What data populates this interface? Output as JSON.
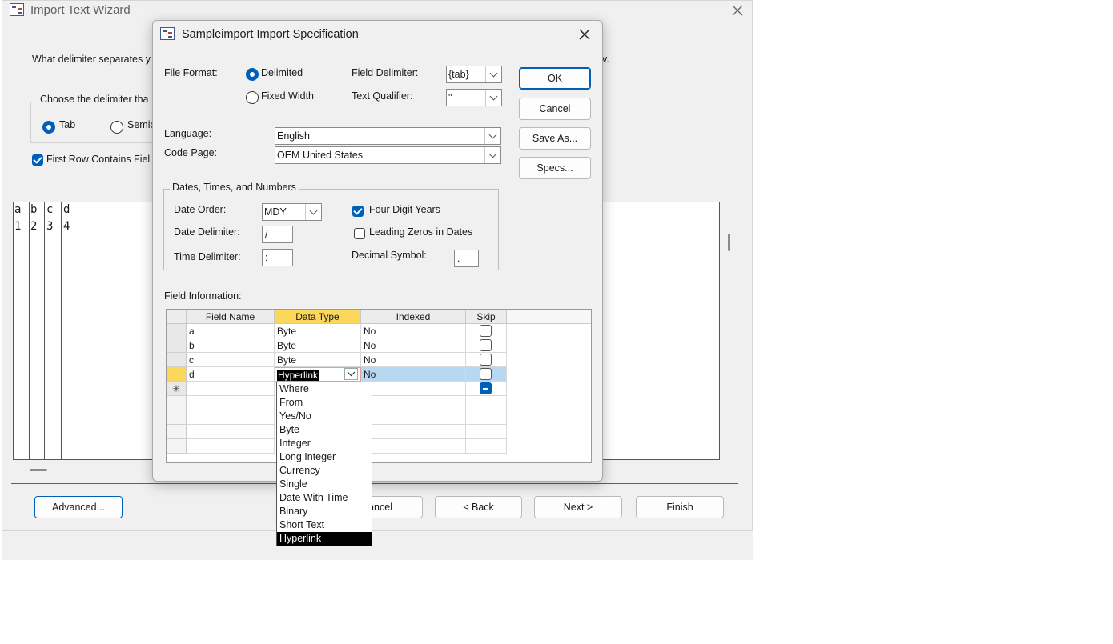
{
  "wizard": {
    "title": "Import Text Wizard",
    "question": "What delimiter separates y",
    "question_end": "v.",
    "delimiter_group": "Choose the delimiter tha",
    "options": [
      {
        "label": "Tab",
        "checked": true
      },
      {
        "label": "Semic",
        "checked": false
      }
    ],
    "first_row": {
      "label": "First Row Contains Fiel",
      "checked": true
    },
    "preview": {
      "headers": [
        "a",
        "b",
        "c",
        "d"
      ],
      "rows": [
        [
          "1",
          "2",
          "3",
          "4"
        ]
      ]
    },
    "buttons": {
      "advanced": "Advanced...",
      "cancel": "ancel",
      "back": "< Back",
      "next": "Next >",
      "finish": "Finish"
    }
  },
  "spec": {
    "title": "Sampleimport Import Specification",
    "file_format_label": "File Format:",
    "format_options": [
      {
        "label": "Delimited",
        "checked": true
      },
      {
        "label": "Fixed Width",
        "checked": false
      }
    ],
    "field_delimiter_label": "Field Delimiter:",
    "field_delimiter_value": "{tab}",
    "text_qualifier_label": "Text Qualifier:",
    "text_qualifier_value": "\"",
    "language_label": "Language:",
    "language_value": "English",
    "code_page_label": "Code Page:",
    "code_page_value": "OEM United States",
    "buttons": {
      "ok": "OK",
      "cancel": "Cancel",
      "save_as": "Save As...",
      "specs": "Specs..."
    },
    "dates_group": "Dates, Times, and Numbers",
    "date_order_label": "Date Order:",
    "date_order_value": "MDY",
    "date_delimiter_label": "Date Delimiter:",
    "date_delimiter_value": "/",
    "time_delimiter_label": "Time Delimiter:",
    "time_delimiter_value": ":",
    "four_digit_years": {
      "label": "Four Digit Years",
      "checked": true
    },
    "leading_zeros": {
      "label": "Leading Zeros in Dates",
      "checked": false
    },
    "decimal_symbol_label": "Decimal Symbol:",
    "decimal_symbol_value": ".",
    "field_info_label": "Field Information:",
    "columns": [
      "Field Name",
      "Data Type",
      "Indexed",
      "Skip"
    ],
    "rows": [
      {
        "name": "a",
        "type": "Byte",
        "indexed": "No"
      },
      {
        "name": "b",
        "type": "Byte",
        "indexed": "No"
      },
      {
        "name": "c",
        "type": "Byte",
        "indexed": "No"
      },
      {
        "name": "d",
        "type": "Hyperlink",
        "indexed": "No"
      }
    ],
    "new_row_marker": "✳",
    "type_options": [
      "Where",
      "From",
      "Yes/No",
      "Byte",
      "Integer",
      "Long Integer",
      "Currency",
      "Single",
      "Date With Time",
      "Binary",
      "Short Text",
      "Hyperlink"
    ],
    "selected_type": "Hyperlink"
  },
  "colors": {
    "accent": "#005fb8",
    "active_column": "#fbd75b",
    "selected_row": "#b8d7f1"
  }
}
